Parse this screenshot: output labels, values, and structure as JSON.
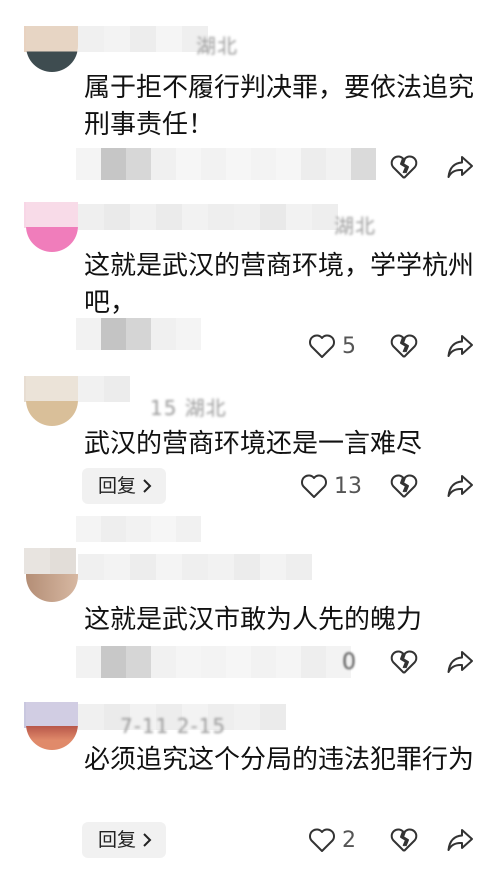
{
  "comments": [
    {
      "meta": "湖北",
      "text": "属于拒不履行判决罪，要依法追究刑事责任！",
      "reply_label": "",
      "like_count": ""
    },
    {
      "meta": "湖北",
      "text": "这就是武汉的营商环境，学学杭州吧，",
      "reply_label": "",
      "like_count": "5"
    },
    {
      "meta": "15 湖北",
      "text": "武汉的营商环境还是一言难尽",
      "reply_label": "回复",
      "like_count": "13"
    },
    {
      "meta": "",
      "text": "这就是武汉市敢为人先的魄力",
      "reply_label": "",
      "like_count": "0"
    },
    {
      "meta": "7-11 2-15",
      "text": "必须追究这个分局的违法犯罪行为",
      "reply_label": "回复",
      "like_count": "2"
    }
  ],
  "icons": {
    "like": "heart-outline-icon",
    "dislike": "broken-heart-icon",
    "share": "share-arrow-icon",
    "chevron": "chevron-right-icon"
  },
  "colors": {
    "text": "#111111",
    "meta": "#9a9a9a",
    "icon": "#333333",
    "reply_bg": "#f1f1f1"
  }
}
